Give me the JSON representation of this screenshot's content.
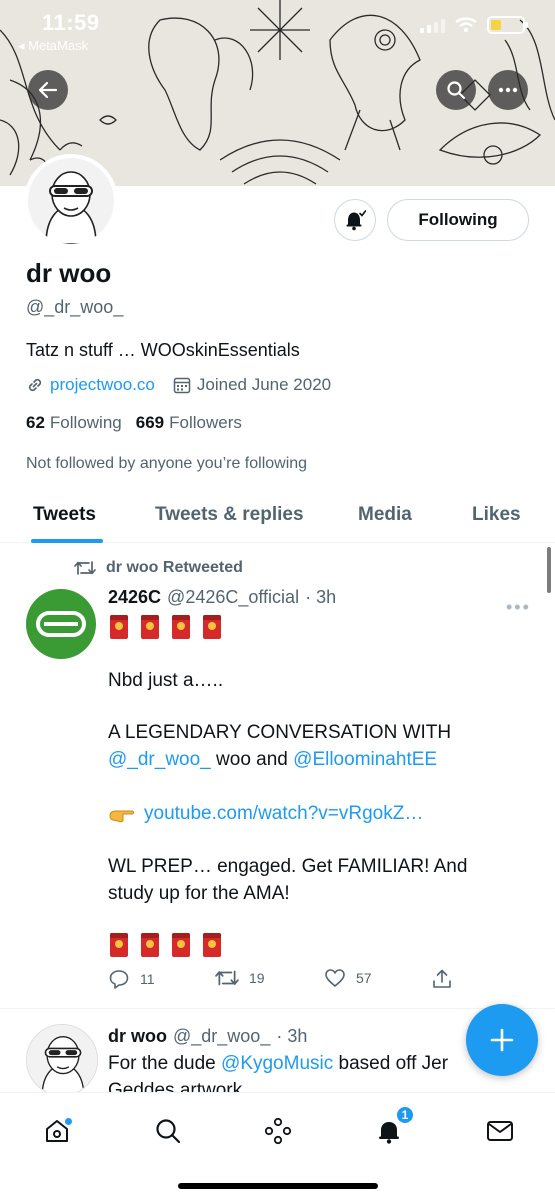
{
  "status_bar": {
    "time": "11:59",
    "back_app": "◂ MetaMask"
  },
  "profile": {
    "name": "dr woo",
    "handle": "@_dr_woo_",
    "bio": "Tatz n stuff … WOOskinEssentials",
    "link": "projectwoo.co",
    "joined": "Joined June 2020",
    "following_count": "62",
    "following_label": "Following",
    "followers_count": "669",
    "followers_label": "Followers",
    "not_followed": "Not followed by anyone you’re following",
    "follow_button_label": "Following"
  },
  "tabs": [
    {
      "label": "Tweets",
      "active": true
    },
    {
      "label": "Tweets & replies",
      "active": false
    },
    {
      "label": "Media",
      "active": false
    },
    {
      "label": "Likes",
      "active": false
    }
  ],
  "tweet1": {
    "retweet_label": "dr woo Retweeted",
    "display_name": "2426C",
    "handle": "@2426C_official",
    "time": "· 3h",
    "line1": "Nbd just a…..",
    "line2": "A LEGENDARY CONVERSATION WITH",
    "mention1": "@_dr_woo_",
    "text_mid": " woo and ",
    "mention2": "@ElloominahtEE",
    "link": "youtube.com/watch?v=vRgokZ…",
    "line4": "WL PREP… engaged. Get FAMILIAR! And",
    "line5": "study up for the AMA!",
    "replies": "11",
    "retweets": "19",
    "likes": "57"
  },
  "tweet2": {
    "display_name": "dr woo",
    "handle": "@_dr_woo_",
    "time": "· 3h",
    "text_start": "For the dude ",
    "mention": "@KygoMusic",
    "text_end": "  based off Jer",
    "line2": "Geddes artwork"
  },
  "nav": {
    "notifications_badge": "1"
  },
  "colors": {
    "accent": "#1d9bf0",
    "text": "#0f1419",
    "muted": "#536471",
    "avatar_green": "#3a9b35"
  }
}
